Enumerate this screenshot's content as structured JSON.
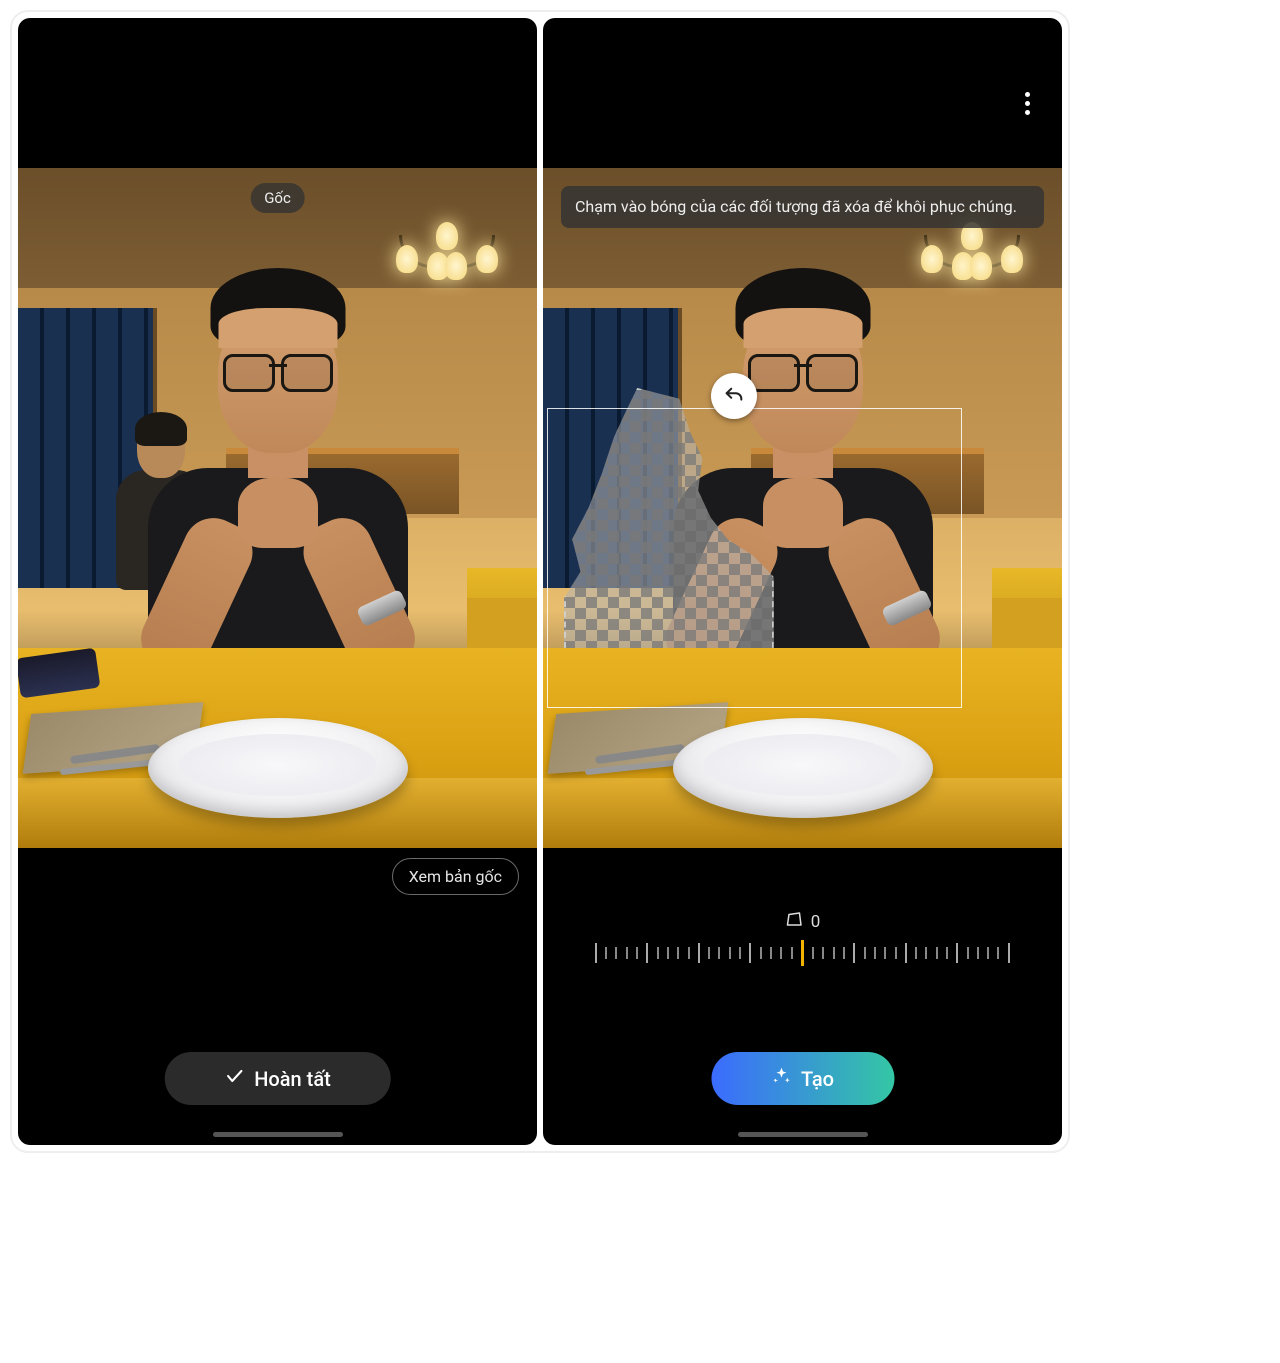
{
  "left": {
    "chip_original": "Gốc",
    "view_original_btn": "Xem bản gốc",
    "done_btn": "Hoàn tất"
  },
  "right": {
    "tooltip": "Chạm vào bóng của các đối tượng đã xóa để khôi phục chúng.",
    "slider_value": "0",
    "create_btn": "Tạo"
  }
}
